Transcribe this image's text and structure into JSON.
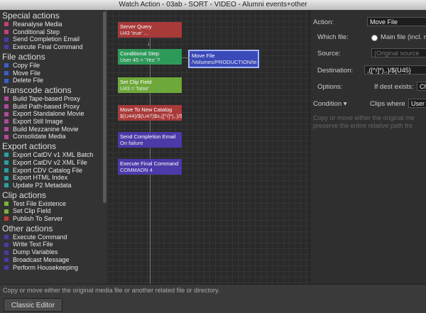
{
  "window": {
    "title": "Watch Action - 03ab - SORT - VIDEO - Alumni events+other"
  },
  "sidebar": {
    "groups": [
      {
        "title": "Special actions",
        "items": [
          {
            "label": "Reanalyse Media",
            "color": "#c0407a"
          },
          {
            "label": "Conditional Step",
            "color": "#c0407a"
          },
          {
            "label": "Send Completion Email",
            "color": "#4b3aa8"
          },
          {
            "label": "Execute Final Command",
            "color": "#4b3aa8"
          }
        ]
      },
      {
        "title": "File actions",
        "items": [
          {
            "label": "Copy File",
            "color": "#3a5fc8"
          },
          {
            "label": "Move File",
            "color": "#3a5fc8"
          },
          {
            "label": "Delete File",
            "color": "#3a5fc8"
          }
        ]
      },
      {
        "title": "Transcode actions",
        "items": [
          {
            "label": "Build Tape-based Proxy",
            "color": "#b04a9a"
          },
          {
            "label": "Build Path-based Proxy",
            "color": "#b04a9a"
          },
          {
            "label": "Export Standalone Movie",
            "color": "#b04a9a"
          },
          {
            "label": "Export Still Image",
            "color": "#b04a9a"
          },
          {
            "label": "Build Mezzanine Movie",
            "color": "#b04a9a"
          },
          {
            "label": "Consolidate Media",
            "color": "#b04a9a"
          }
        ]
      },
      {
        "title": "Export actions",
        "items": [
          {
            "label": "Export CatDV v1 XML Batch",
            "color": "#2aa0a0"
          },
          {
            "label": "Export CatDV v2 XML File",
            "color": "#2aa0a0"
          },
          {
            "label": "Export CDV Catalog File",
            "color": "#2aa0a0"
          },
          {
            "label": "Export HTML Index",
            "color": "#2aa0a0"
          },
          {
            "label": "Update P2 Metadata",
            "color": "#2aa0a0"
          }
        ]
      },
      {
        "title": "Clip actions",
        "items": [
          {
            "label": "Test File Existence",
            "color": "#7cb33a"
          },
          {
            "label": "Set Clip Field",
            "color": "#7cb33a"
          },
          {
            "label": "Publish To Server",
            "color": "#c03a3a"
          }
        ]
      },
      {
        "title": "Other actions",
        "items": [
          {
            "label": "Execute Command",
            "color": "#4b3aa8"
          },
          {
            "label": "Write Text File",
            "color": "#4b3aa8"
          },
          {
            "label": "Dump Variables",
            "color": "#4b3aa8"
          },
          {
            "label": "Broadcast Message",
            "color": "#4b3aa8"
          },
          {
            "label": "Perform Housekeeping",
            "color": "#4b3aa8"
          }
        ]
      }
    ]
  },
  "workflow": {
    "nodes": [
      {
        "title": "Server Query",
        "subtitle": "U43 'true' ...",
        "color": "#a83a3a"
      },
      {
        "title": "Conditional Step",
        "subtitle": "User 45 = 'Yes' ?",
        "color": "#2e9a5a"
      },
      {
        "title": "Move File",
        "subtitle": "/Volumes/PRODUCTION/te",
        "color": "#3a4ab8"
      },
      {
        "title": "Set Clip Field",
        "subtitle": "U43 = 'false'",
        "color": "#6ea83a"
      },
      {
        "title": "Move To New Catalog",
        "subtitle": "$(U44)/$(U47)$s,([^/]*),.}/$",
        "color": "#a83a3a"
      },
      {
        "title": "Send Completion Email",
        "subtitle": "On failure",
        "color": "#4b3aa8"
      },
      {
        "title": "Execute Final Command",
        "subtitle": "COMMADN 4",
        "color": "#4b3aa8"
      }
    ]
  },
  "panel": {
    "action_label": "Action:",
    "action_value": "Move File",
    "which_file_label": "Which file:",
    "which_file_value": "Main file (incl. m",
    "source_label": "Source:",
    "source_placeholder": "(Original source",
    "destination_label": "Destination:",
    "destination_value": ",([^/]*),.}/${U45}",
    "options_label": "Options:",
    "if_dest_label": "If dest exists:",
    "if_dest_value": "Ch",
    "condition_label": "Condition ▾",
    "clips_where_label": "Clips where",
    "clips_where_value": "User",
    "help_text": "Copy or move either the original me preserve the entire relative path fro"
  },
  "status": {
    "message": "Copy or move either the original media file or another related file or directory.",
    "classic_editor_label": "Classic Editor"
  }
}
